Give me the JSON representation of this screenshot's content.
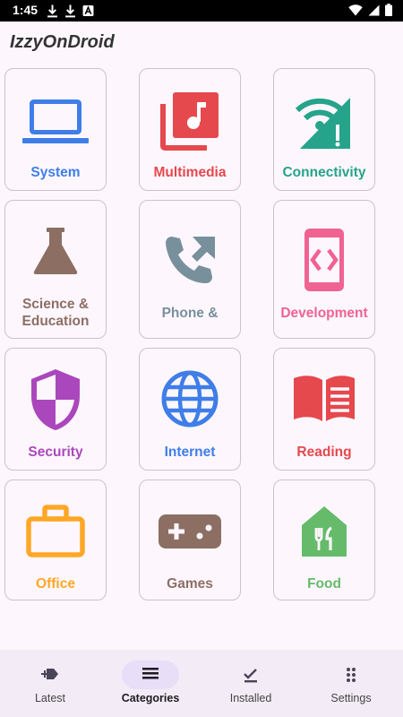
{
  "status_bar": {
    "time": "1:45",
    "left_icons": [
      "download-icon",
      "download-icon",
      "app-notification-icon"
    ],
    "right_icons": [
      "wifi-icon",
      "cellular-signal-icon",
      "battery-icon"
    ]
  },
  "app_title": "IzzyOnDroid",
  "categories": [
    {
      "label": "System",
      "icon": "laptop-icon",
      "color": "#3f7ee8"
    },
    {
      "label": "Multimedia",
      "icon": "music-library-icon",
      "color": "#e5484d"
    },
    {
      "label": "Connectivity",
      "icon": "wifi-signal-icon",
      "color": "#26a38b"
    },
    {
      "label_line1": "Science &",
      "label_line2": "Education",
      "icon": "flask-icon",
      "color": "#8d6e63"
    },
    {
      "label": "Phone &",
      "icon": "phone-forward-icon",
      "color": "#78909c"
    },
    {
      "label": "Development",
      "icon": "code-phone-icon",
      "color": "#f06292"
    },
    {
      "label": "Security",
      "icon": "shield-icon",
      "color": "#ab47bc"
    },
    {
      "label": "Internet",
      "icon": "globe-icon",
      "color": "#3f7ee8"
    },
    {
      "label": "Reading",
      "icon": "book-icon",
      "color": "#e5484d"
    },
    {
      "label": "Office",
      "icon": "briefcase-icon",
      "color": "#ffa726"
    },
    {
      "label": "Games",
      "icon": "gamepad-icon",
      "color": "#8d6e63"
    },
    {
      "label": "Food",
      "icon": "restaurant-icon",
      "color": "#66bb6a"
    }
  ],
  "bottom_nav": {
    "items": [
      {
        "label": "Latest",
        "icon": "new-label-icon"
      },
      {
        "label": "Categories",
        "icon": "list-icon",
        "active": true
      },
      {
        "label": "Installed",
        "icon": "check-icon"
      },
      {
        "label": "Settings",
        "icon": "dots-icon"
      }
    ]
  }
}
